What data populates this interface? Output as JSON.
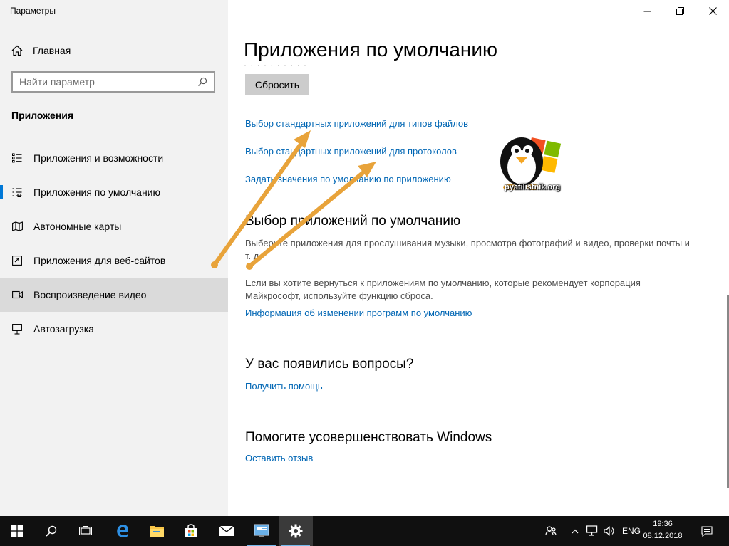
{
  "window": {
    "title": "Параметры"
  },
  "sidebar": {
    "home_label": "Главная",
    "search_placeholder": "Найти параметр",
    "section_title": "Приложения",
    "items": [
      {
        "label": "Приложения и возможности",
        "icon": "apps-features-icon"
      },
      {
        "label": "Приложения по умолчанию",
        "icon": "default-apps-icon",
        "active": true
      },
      {
        "label": "Автономные карты",
        "icon": "offline-maps-icon"
      },
      {
        "label": "Приложения для веб-сайтов",
        "icon": "apps-for-websites-icon"
      },
      {
        "label": "Воспроизведение видео",
        "icon": "video-playback-icon",
        "hover": true
      },
      {
        "label": "Автозагрузка",
        "icon": "startup-icon"
      }
    ]
  },
  "main": {
    "title": "Приложения по умолчанию",
    "ghost_text": "· ·   · ·         ·  ·        ·  ·     ·  ·",
    "reset_label": "Сбросить",
    "links": {
      "by_file_type": "Выбор стандартных приложений для типов файлов",
      "by_protocol": "Выбор стандартных приложений для протоколов",
      "by_app": "Задать значения по умолчанию по приложению"
    },
    "choose_section": {
      "heading": "Выбор приложений по умолчанию",
      "desc1": "Выберите приложения для прослушивания музыки, просмотра фотографий и видео, проверки почты и т. д.",
      "desc2": "Если вы хотите вернуться к приложениям по умолчанию, которые рекомендует корпорация Майкрософт, используйте функцию сброса.",
      "info_link": "Информация об изменении программ по умолчанию"
    },
    "questions": {
      "heading": "У вас появились вопросы?",
      "link": "Получить помощь"
    },
    "improve": {
      "heading": "Помогите усовершенствовать Windows",
      "link": "Оставить отзыв"
    }
  },
  "overlay": {
    "logo_text": "pyatilistnik.org",
    "arrow_color": "#e8a33a"
  },
  "taskbar": {
    "lang": "ENG",
    "time": "19:36",
    "date": "08.12.2018"
  },
  "colors": {
    "accent": "#0078d7",
    "link": "#0066b4",
    "sidebar_bg": "#f2f2f2",
    "taskbar_bg": "#101010"
  }
}
